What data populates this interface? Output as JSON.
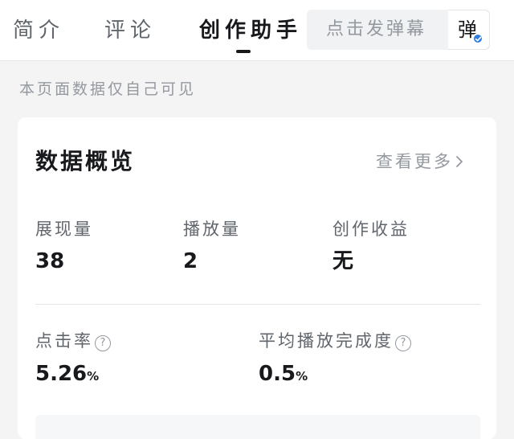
{
  "tabs": [
    {
      "label": "简介",
      "active": false
    },
    {
      "label": "评论",
      "active": false
    },
    {
      "label": "创作助手",
      "active": true
    }
  ],
  "danmaku": {
    "placeholder": "点击发弹幕",
    "toggle_label": "弹"
  },
  "notice": "本页面数据仅自己可见",
  "overview": {
    "title": "数据概览",
    "more_label": "查看更多",
    "stats_row1": [
      {
        "label": "展现量",
        "value": "38"
      },
      {
        "label": "播放量",
        "value": "2"
      },
      {
        "label": "创作收益",
        "value": "无"
      }
    ],
    "stats_row2": [
      {
        "label": "点击率",
        "value": "5.26",
        "unit": "%"
      },
      {
        "label": "平均播放完成度",
        "value": "0.5",
        "unit": "%"
      }
    ],
    "help_glyph": "?"
  },
  "colors": {
    "accent": "#2f7de1",
    "text_primary": "#18191c",
    "text_secondary": "#61666d",
    "text_muted": "#9499a0"
  }
}
